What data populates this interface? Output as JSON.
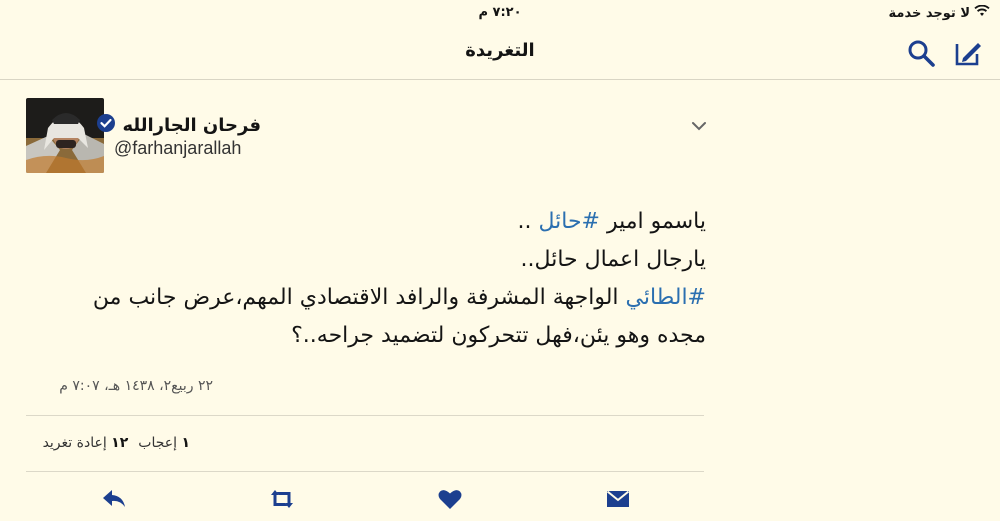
{
  "status_bar": {
    "carrier": "لا توجد خدمة",
    "time": "٧:٢٠ م"
  },
  "navbar": {
    "title": "التغريدة",
    "icons": [
      "compose-icon",
      "search-icon"
    ]
  },
  "tweet": {
    "author_name": "فرحان الجارالله",
    "handle": "@farhanjarallah",
    "verified": true,
    "lines": {
      "l1_pre": "ياسمو امير ",
      "l1_tag": "#حائل",
      "l1_post": " ..",
      "l2": "يارجال اعمال حائل..",
      "l3_tag": "#الطائي",
      "l3_post": " الواجهة المشرفة والرافد الاقتصادي المهم،عرض جانب من",
      "l4": "مجده وهو يئن،فهل تتحركون لتضميد جراحه..؟"
    },
    "timestamp": "٢٢ ربيع٢، ١٤٣٨ هـ، ٧:٠٧ م",
    "stats": {
      "likes_count": "١",
      "likes_label": "إعجاب",
      "retweets_count": "١٢",
      "retweets_label": "إعادة تغريد"
    }
  },
  "colors": {
    "background": "#fffbe8",
    "accent": "#2b6fb0",
    "icon": "#1c3f8f"
  }
}
